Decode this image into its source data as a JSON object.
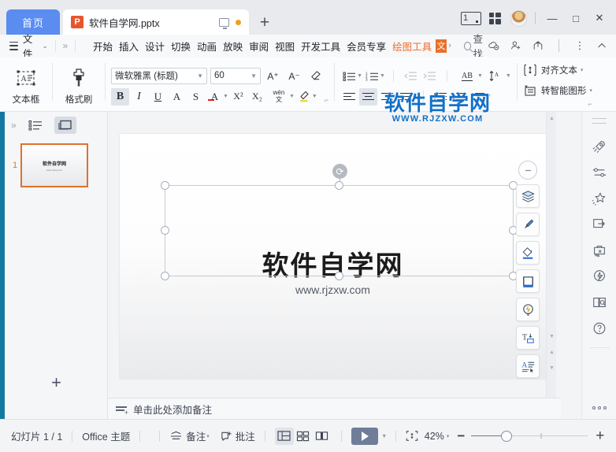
{
  "titlebar": {
    "home_tab": "首页",
    "doc_tab": {
      "icon": "pptx-icon",
      "icon_glyph": "P",
      "name": "软件自学网.pptx",
      "present_icon": "monitor-icon",
      "modified_dot": "unsaved-dot"
    },
    "new_tab_label": "+",
    "window_count": "1",
    "grid_icon": "app-grid-icon",
    "avatar": "user-avatar",
    "minimize": "—",
    "maximize": "□",
    "close": "✕"
  },
  "menubar": {
    "file_label": "文件",
    "file_chevron": "⌄",
    "expand_icon": "»",
    "items": [
      {
        "label": "开始",
        "state": "normal"
      },
      {
        "label": "插入",
        "state": "normal"
      },
      {
        "label": "设计",
        "state": "normal"
      },
      {
        "label": "切换",
        "state": "normal"
      },
      {
        "label": "动画",
        "state": "normal"
      },
      {
        "label": "放映",
        "state": "normal"
      },
      {
        "label": "审阅",
        "state": "normal"
      },
      {
        "label": "视图",
        "state": "normal"
      },
      {
        "label": "开发工具",
        "state": "normal"
      },
      {
        "label": "会员专享",
        "state": "normal"
      },
      {
        "label": "绘图工具",
        "state": "active"
      }
    ],
    "overflow_badge": "文",
    "overflow_arrow": "›",
    "search_label": "查找",
    "right_icons": [
      "cloud-sync-icon",
      "add-user-icon",
      "share-icon",
      "more-icon",
      "collapse-ribbon-icon"
    ]
  },
  "ribbon": {
    "textbox_button": {
      "label": "文本框",
      "icon": "textbox-icon",
      "caret": "▾"
    },
    "format_painter": {
      "label": "格式刷",
      "icon": "format-painter-icon"
    },
    "font_name": "微软雅黑 (标题)",
    "font_size": "60",
    "grow_font": "A⁺",
    "shrink_font": "A⁻",
    "clear_format": "clear-format-icon",
    "bold": "B",
    "italic": "I",
    "underline": "U",
    "strikethrough_a": "A",
    "strikethrough_s": "S",
    "font_color": "A",
    "superscript": "X²",
    "subscript": "X₂",
    "pinyin": "wén",
    "highlight": "highlight-icon",
    "bullets": "bullet-list-icon",
    "numbering": "numbered-list-icon",
    "decrease_indent": "decrease-indent-icon",
    "increase_indent": "increase-indent-icon",
    "text_direction": "AB",
    "line_spacing": "line-spacing-icon",
    "align_left": "align-left-icon",
    "align_center": "align-center-icon",
    "align_right": "align-right-icon",
    "align_justify": "align-justify-icon",
    "align_distribute": "align-distribute-icon",
    "column_a": "columns-icon-a",
    "column_b": "columns-icon-b",
    "column_c": "columns-icon-c",
    "align_text": {
      "label": "对齐文本",
      "icon": "align-text-icon",
      "caret": "▾"
    },
    "smart_art": {
      "label": "转智能图形",
      "icon": "smartart-icon",
      "caret": "▾"
    }
  },
  "watermark": {
    "line1": "软件自学网",
    "line2": "WWW.RJZXW.COM"
  },
  "left_panel": {
    "collapse_icon": "»",
    "outline_icon": "outline-view-icon",
    "slides_icon": "slides-view-icon",
    "slides": [
      {
        "number": "1",
        "title": "软件自学网",
        "subtitle": "www.rjzxw.com"
      }
    ],
    "add_slide": "+"
  },
  "canvas": {
    "slide": {
      "title": "软件自学网",
      "subtitle": "www.rjzxw.com"
    },
    "selection": {
      "rotate_handle": "rotate-icon",
      "handles": 8
    },
    "float_tools": [
      {
        "name": "collapse-tools-icon"
      },
      {
        "name": "layers-icon"
      },
      {
        "name": "brush-icon"
      },
      {
        "name": "shape-fill-icon"
      },
      {
        "name": "frame-icon"
      },
      {
        "name": "smart-idea-icon"
      },
      {
        "name": "text-fit-icon"
      },
      {
        "name": "text-effects-icon"
      }
    ]
  },
  "notes": {
    "icon": "add-notes-icon",
    "placeholder": "单击此处添加备注"
  },
  "right_rail": {
    "grip": "drag-grip",
    "items": [
      {
        "name": "rocket-icon"
      },
      {
        "name": "sliders-icon"
      },
      {
        "name": "sparkle-star-icon"
      },
      {
        "name": "screen-share-icon"
      },
      {
        "name": "toolbox-icon"
      },
      {
        "name": "lightning-bulb-icon"
      },
      {
        "name": "book-search-icon"
      },
      {
        "name": "help-icon"
      }
    ],
    "more": "more-dots-icon"
  },
  "statusbar": {
    "slide_counter": "幻灯片 1 / 1",
    "theme": "Office 主题",
    "notes_button": {
      "label": "备注",
      "icon": "notes-icon",
      "caret": "▾"
    },
    "comment_button": {
      "label": "批注",
      "icon": "comment-icon"
    },
    "views": [
      {
        "name": "normal-view-icon",
        "active": true
      },
      {
        "name": "slide-sorter-icon",
        "active": false
      },
      {
        "name": "reading-view-icon",
        "active": false
      }
    ],
    "play_button": {
      "icon": "play-icon",
      "caret": "▾"
    },
    "fit_button": "fit-to-window-icon",
    "zoom_level": "42%",
    "zoom_caret": "▾",
    "zoom_out": "−",
    "zoom_in": "+"
  },
  "colors": {
    "accent_blue": "#5b8cf0",
    "brand_orange": "#e8702a",
    "watermark_blue": "#1470c8",
    "left_strip": "#1478a0",
    "play_button": "#6f7d99"
  }
}
